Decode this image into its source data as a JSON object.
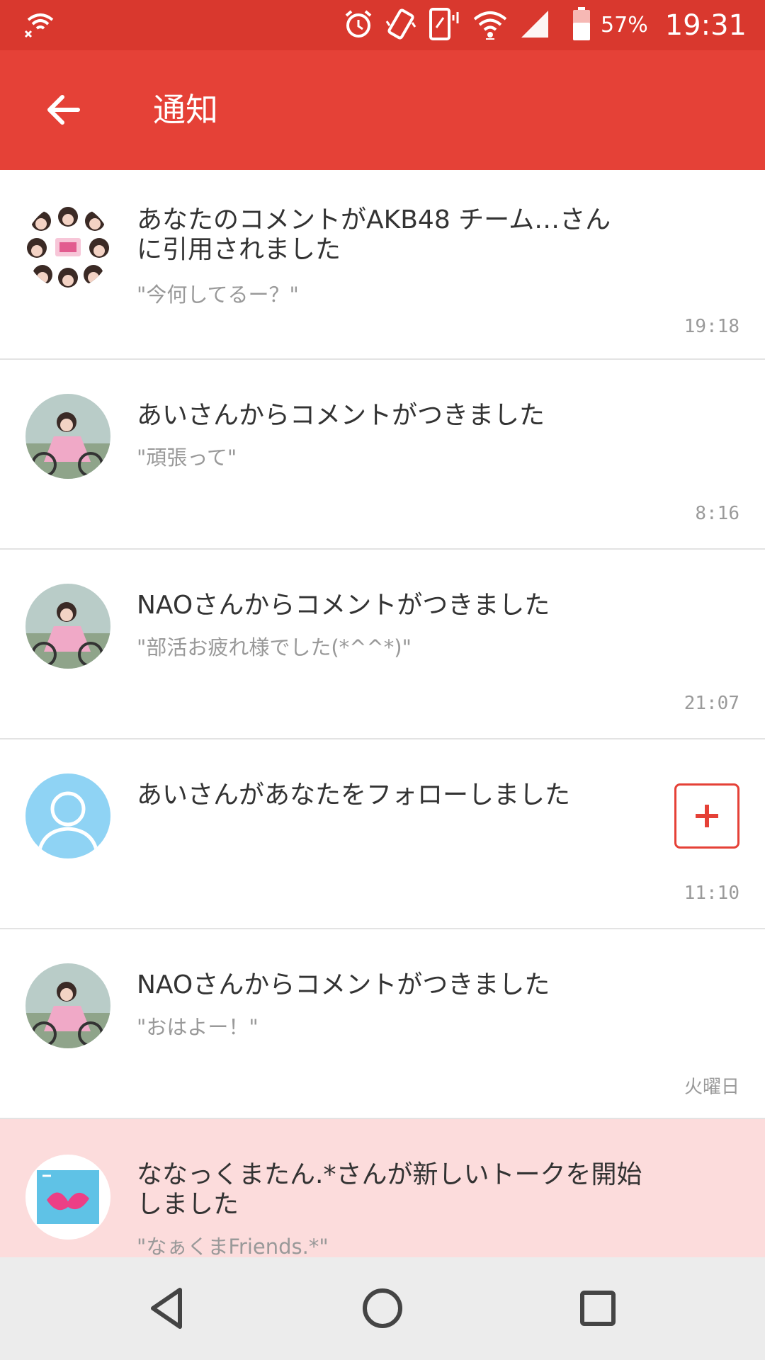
{
  "status_bar": {
    "icons": [
      "wifi-off-icon",
      "alarm-icon",
      "vibrate-icon",
      "phone-signal-icon",
      "wifi-icon",
      "cell-signal-icon",
      "battery-icon"
    ],
    "battery_percent": "57%",
    "time": "19:31"
  },
  "app_bar": {
    "title": "通知",
    "color": "#e54137"
  },
  "notifications": [
    {
      "title": "あなたのコメントがAKB48 チーム…さんに引用されました",
      "snippet": "\"今何してるー？\"",
      "time": "19:18",
      "avatar": "group-photo-avatar"
    },
    {
      "title": "あいさんからコメントがつきました",
      "snippet": "\"頑張って\"",
      "time": "8:16",
      "avatar": "user-photo-avatar"
    },
    {
      "title": "NAOさんからコメントがつきました",
      "snippet": "\"部活お疲れ様でした(*^^*)\"",
      "time": "21:07",
      "avatar": "user-photo-avatar"
    },
    {
      "title": "あいさんがあなたをフォローしました",
      "time": "11:10",
      "avatar": "default-user-avatar",
      "action": "follow-plus-icon"
    },
    {
      "title": "NAOさんからコメントがつきました",
      "snippet": "\"おはよー！\"",
      "time": "火曜日",
      "avatar": "user-photo-avatar"
    },
    {
      "title": "ななっくまたん.*さんが新しいトークを開始しました",
      "snippet": "\"なぁくまFriends.*\"",
      "avatar": "talk-image-avatar",
      "highlight_color": "#fcdcdc"
    }
  ],
  "nav_bar": {
    "buttons": [
      "back-triangle-icon",
      "home-circle-icon",
      "recents-square-icon"
    ]
  }
}
